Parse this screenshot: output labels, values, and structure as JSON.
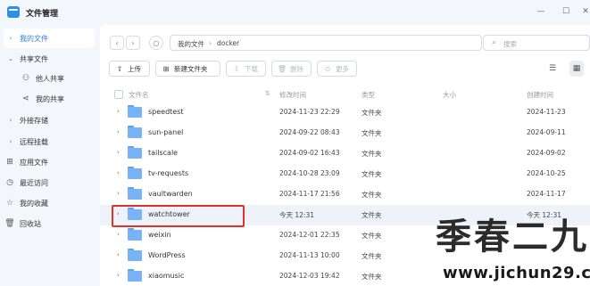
{
  "app": {
    "title": "文件管理"
  },
  "window": {
    "minimize": "—",
    "maximize": "☐",
    "close": "✕"
  },
  "sidebar": {
    "items": [
      {
        "label": "我的文件",
        "arrow": "›",
        "active": true
      },
      {
        "label": "共享文件",
        "arrow": "⌄"
      },
      {
        "label": "他人共享",
        "icon": "users-icon"
      },
      {
        "label": "我的共享",
        "icon": "share-icon"
      },
      {
        "label": "外接存储",
        "arrow": "›"
      },
      {
        "label": "远程挂载",
        "arrow": "›"
      },
      {
        "label": "应用文件",
        "icon": "apps-icon"
      },
      {
        "label": "最近访问",
        "icon": "clock-icon"
      },
      {
        "label": "我的收藏",
        "icon": "star-icon"
      },
      {
        "label": "回收站",
        "icon": "trash-icon"
      }
    ]
  },
  "path": {
    "root": "我的文件",
    "sep": "›",
    "current": "docker"
  },
  "search": {
    "placeholder": "搜索"
  },
  "toolbar": {
    "upload": "上传",
    "new_folder": "新建文件夹",
    "download": "下载",
    "delete": "删除",
    "more": "更多"
  },
  "columns": {
    "name": "文件名",
    "mtime": "修改时间",
    "type": "类型",
    "size": "大小",
    "ctime": "创建时间"
  },
  "rows": [
    {
      "name": "speedtest",
      "mtime": "2024-11-23 22:29",
      "type": "文件夹",
      "ctime": "2024-11-23"
    },
    {
      "name": "sun-panel",
      "mtime": "2024-09-22 08:43",
      "type": "文件夹",
      "ctime": "2024-09-11"
    },
    {
      "name": "tailscale",
      "mtime": "2024-09-02 16:43",
      "type": "文件夹",
      "ctime": "2024-09-02"
    },
    {
      "name": "tv-requests",
      "mtime": "2024-10-28 23:09",
      "type": "文件夹",
      "ctime": "2024-10-25"
    },
    {
      "name": "vaultwarden",
      "mtime": "2024-11-17 21:56",
      "type": "文件夹",
      "ctime": "2024-11-17"
    },
    {
      "name": "watchtower",
      "mtime": "今天 12:31",
      "type": "文件夹",
      "ctime": "今天 12:31"
    },
    {
      "name": "weixin",
      "mtime": "2024-12-01 22:35",
      "type": "文件夹",
      "ctime": ""
    },
    {
      "name": "WordPress",
      "mtime": "2024-11-13 10:00",
      "type": "文件夹",
      "ctime": ""
    },
    {
      "name": "xiaomusic",
      "mtime": "2024-12-03 19:42",
      "type": "文件夹",
      "ctime": ""
    }
  ],
  "watermark": {
    "big": "季春二九",
    "small": "www.jichun29.cn"
  },
  "colors": {
    "accent": "#2e7de1",
    "highlight": "#e0312b",
    "folder": "#77b3f6"
  }
}
